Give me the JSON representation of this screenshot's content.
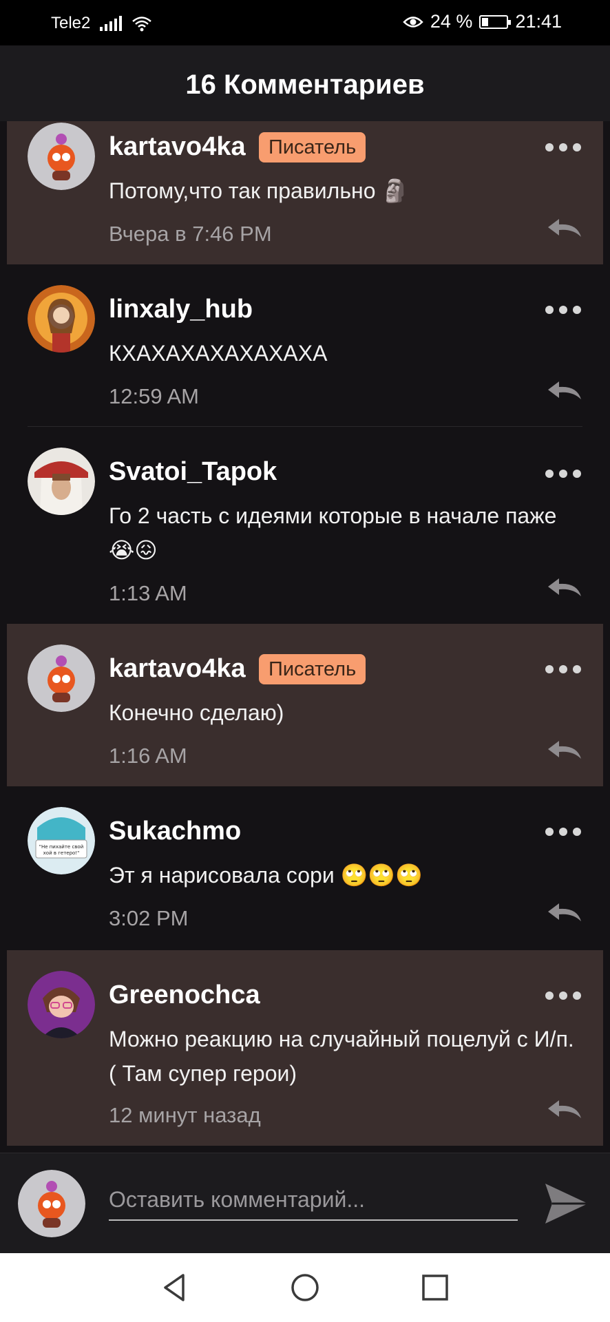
{
  "status_bar": {
    "carrier": "Tele2",
    "battery": "24 %",
    "time": "21:41"
  },
  "header": {
    "title": "16 Комментариев"
  },
  "comments": [
    {
      "author": "kartavo4ka",
      "badge": "Писатель",
      "text": "Потому,что так правильно 🗿",
      "time": "Вчера в 7:46 PM",
      "highlighted": true
    },
    {
      "author": "linxaly_hub",
      "badge": "",
      "text": "КХАХАХАХАХАХАХА",
      "time": "12:59 AM",
      "highlighted": false
    },
    {
      "author": "Svatoi_Tapok",
      "badge": "",
      "text": "Го 2 часть с идеями которые в начале паже😭😖",
      "time": "1:13 AM",
      "highlighted": false
    },
    {
      "author": "kartavo4ka",
      "badge": "Писатель",
      "text": "Конечно сделаю)",
      "time": "1:16 AM",
      "highlighted": true
    },
    {
      "author": "Sukachmo",
      "badge": "",
      "text": "Эт я нарисовала сори 🙄🙄🙄",
      "time": "3:02 PM",
      "highlighted": false
    },
    {
      "author": "Greenochca",
      "badge": "",
      "text": "Можно реакцию на случайный поцелуй с И/п. ( Там супер герои)",
      "time": "12 минут назад",
      "highlighted": true
    }
  ],
  "compose": {
    "placeholder": "Оставить комментарий..."
  },
  "icons": {
    "more": "more-dots-icon",
    "reply": "reply-arrow-icon",
    "send": "send-icon",
    "nav": [
      "back-triangle-icon",
      "home-circle-icon",
      "recents-square-icon"
    ]
  },
  "colors": {
    "background": "#141215",
    "highlight": "#3a2e2d",
    "badge": "#f89d6f",
    "header": "#1c1b1e"
  }
}
